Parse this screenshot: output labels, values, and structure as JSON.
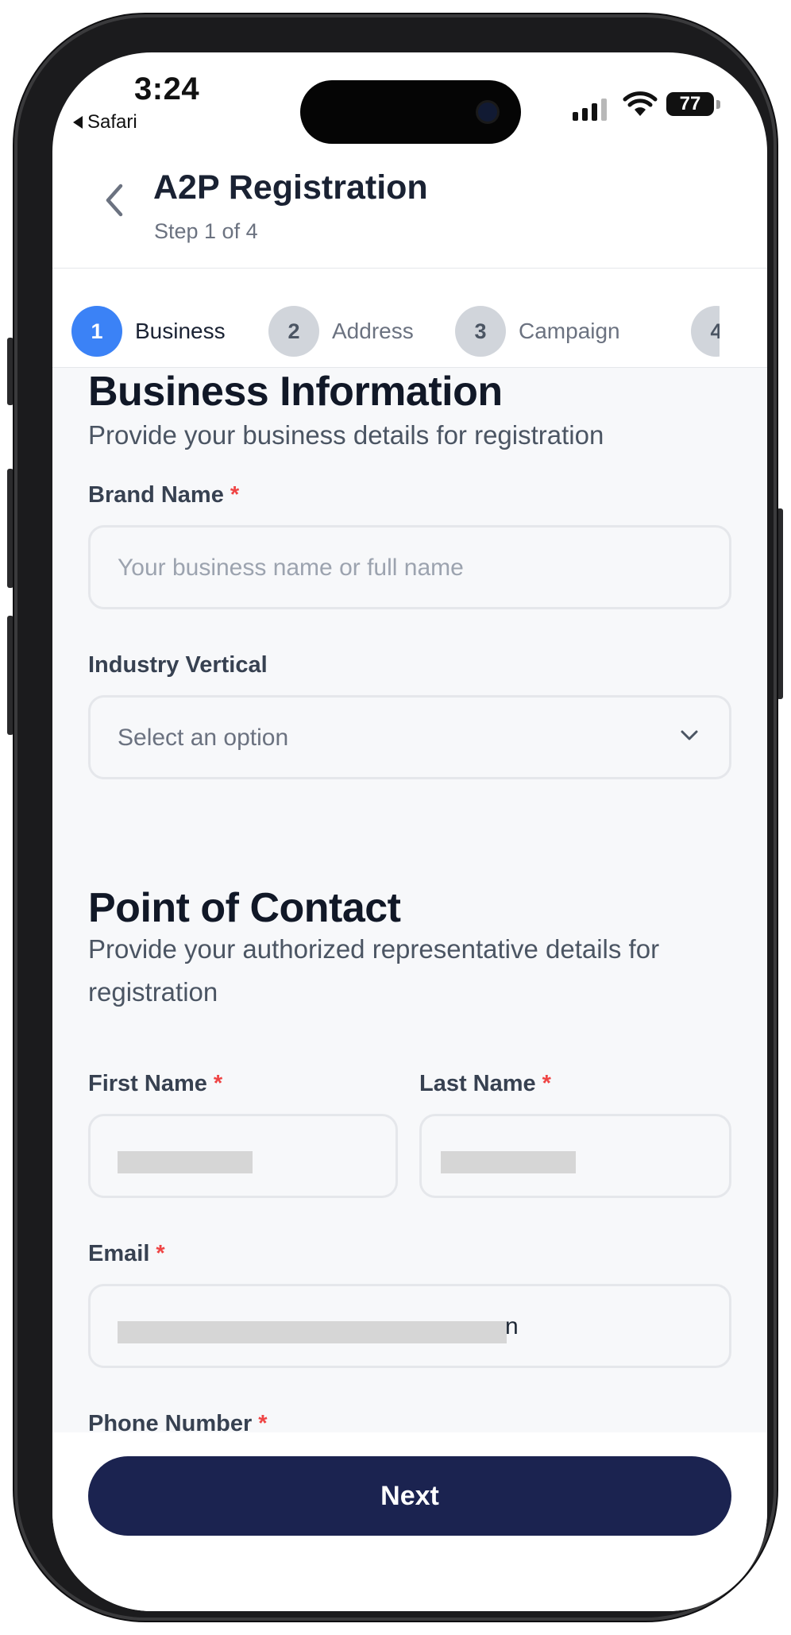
{
  "status_bar": {
    "time": "3:24",
    "back_app": "Safari",
    "battery": "77"
  },
  "header": {
    "title": "A2P Registration",
    "subtitle": "Step 1 of 4"
  },
  "stepper": {
    "steps": [
      {
        "num": "1",
        "label": "Business"
      },
      {
        "num": "2",
        "label": "Address"
      },
      {
        "num": "3",
        "label": "Campaign"
      },
      {
        "num": "4"
      }
    ]
  },
  "business": {
    "heading": "Business Information",
    "description": "Provide your business details for registration",
    "brand_label": "Brand Name",
    "brand_placeholder": "Your business name or full name",
    "industry_label": "Industry Vertical",
    "industry_placeholder": "Select an option"
  },
  "contact": {
    "heading": "Point of Contact",
    "description": "Provide your authorized representative details for registration",
    "first_name_label": "First Name",
    "last_name_label": "Last Name",
    "email_label": "Email",
    "email_visible_suffix": "n",
    "phone_label": "Phone Number"
  },
  "required_mark": "*",
  "footer": {
    "next_label": "Next"
  },
  "colors": {
    "primary_button": "#1b2350",
    "active_step": "#3b82f6",
    "required": "#ef4444"
  }
}
